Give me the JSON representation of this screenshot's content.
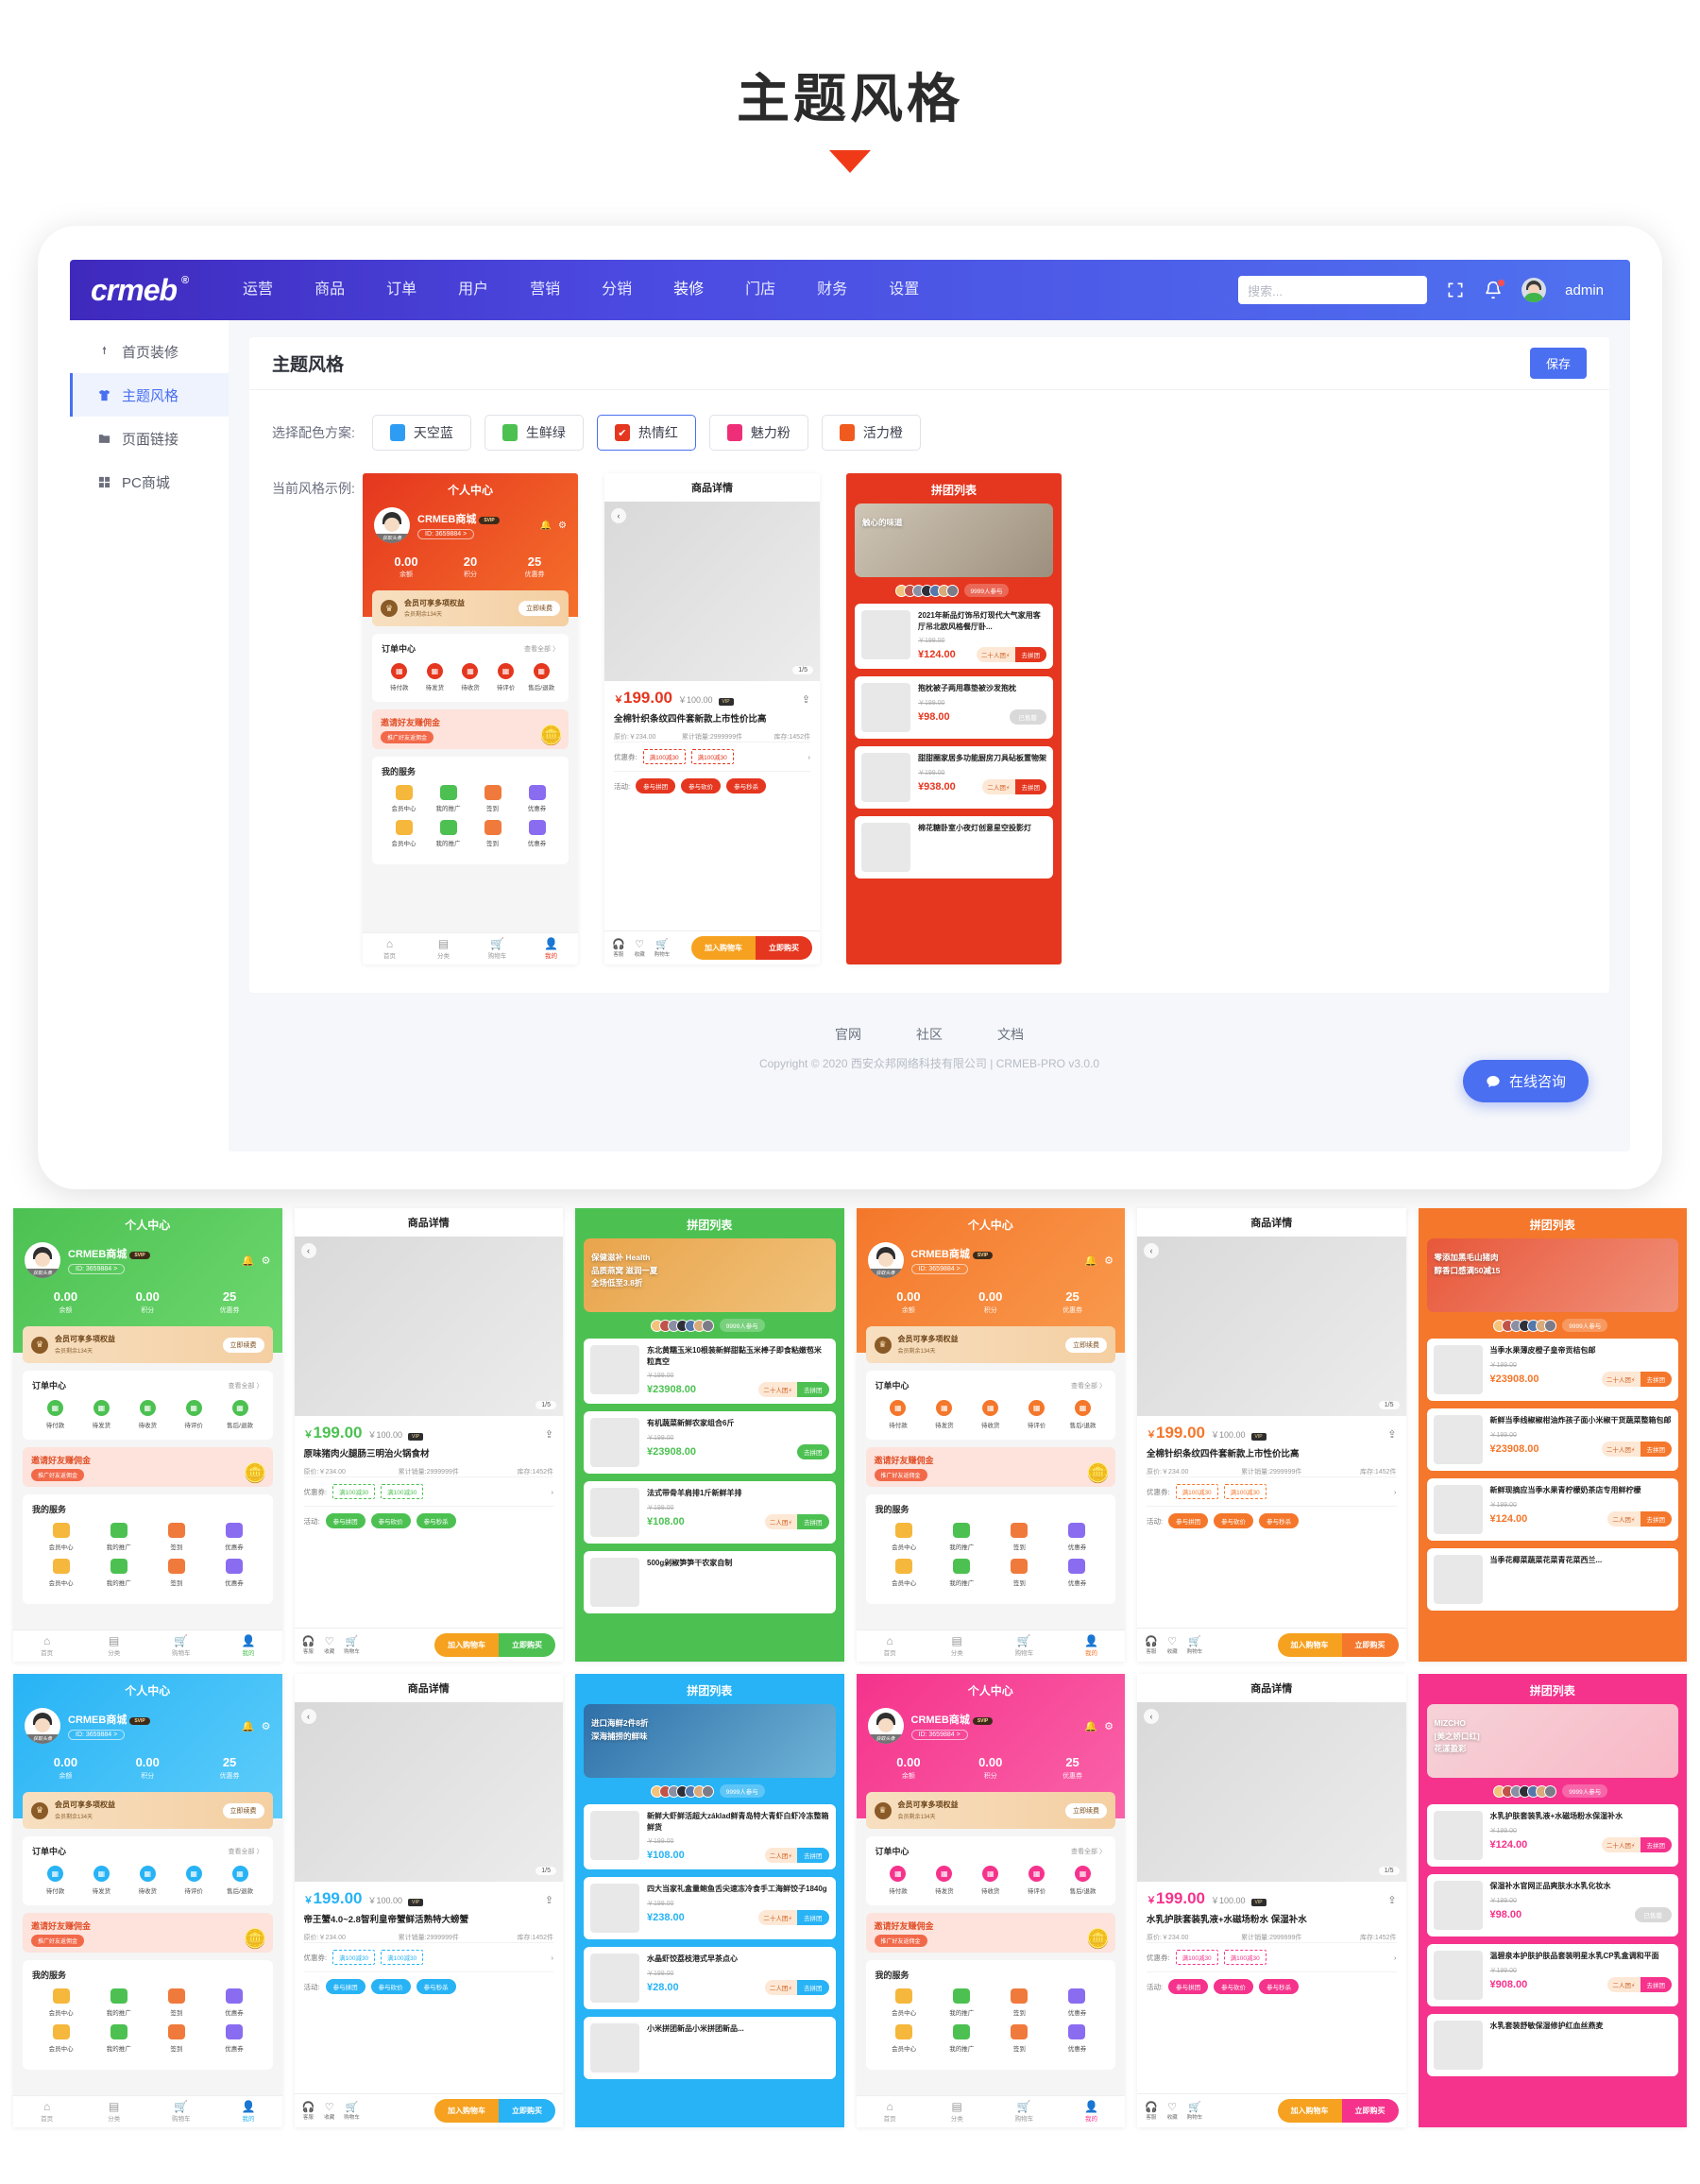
{
  "page": {
    "title": "主题风格"
  },
  "admin": {
    "logo": "crmeb",
    "logo_sup": "®",
    "nav": [
      "运营",
      "商品",
      "订单",
      "用户",
      "营销",
      "分销",
      "装修",
      "门店",
      "财务",
      "设置"
    ],
    "active_nav": "装修",
    "search_placeholder": "搜索...",
    "user_name": "admin",
    "icons": {
      "fullscreen": "fullscreen-icon",
      "bell": "bell-icon",
      "avatar": "avatar-icon",
      "search": "search-icon"
    }
  },
  "sidebar": {
    "items": [
      {
        "label": "首页装修",
        "icon": "pin-icon",
        "active": false
      },
      {
        "label": "主题风格",
        "icon": "shirt-icon",
        "active": true
      },
      {
        "label": "页面链接",
        "icon": "folder-icon",
        "active": false
      },
      {
        "label": "PC商城",
        "icon": "grid-icon",
        "active": false
      }
    ]
  },
  "card": {
    "title": "主题风格",
    "save_label": "保存",
    "scheme_label": "选择配色方案:",
    "schemes": [
      {
        "label": "天空蓝",
        "color": "#2f9cf4",
        "selected": false
      },
      {
        "label": "生鲜绿",
        "color": "#4cc152",
        "selected": false
      },
      {
        "label": "热情红",
        "color": "#e5361f",
        "selected": true
      },
      {
        "label": "魅力粉",
        "color": "#ef2e78",
        "selected": false
      },
      {
        "label": "活力橙",
        "color": "#f05a1e",
        "selected": false
      }
    ],
    "preview_label": "当前风格示例:"
  },
  "footer": {
    "links": [
      "官网",
      "社区",
      "文档"
    ],
    "copyright": "Copyright © 2020 西安众邦网络科技有限公司 | CRMEB-PRO v3.0.0",
    "chat_label": "在线咨询"
  },
  "mobile": {
    "user_center": {
      "title": "个人中心",
      "user_name": "CRMEB商城",
      "avatar_caption": "获取头像",
      "vip_tag": "SVIP",
      "user_id": "ID: 3659884 >",
      "stats": [
        {
          "value": "0.00",
          "label": "余额"
        },
        {
          "value": "0.00",
          "label": "积分"
        },
        {
          "value": "25",
          "label": "优惠券"
        }
      ],
      "stats_main": [
        {
          "value": "0.00",
          "label": "余额"
        },
        {
          "value": "20",
          "label": "积分"
        },
        {
          "value": "25",
          "label": "优惠券"
        }
      ],
      "vip_title": "会员可享多项权益",
      "vip_sub": "会员剩余134天",
      "vip_btn": "立即续费",
      "order_title": "订单中心",
      "order_all": "查看全部 〉",
      "order_items": [
        "待付款",
        "待发货",
        "待收货",
        "待评价",
        "售后/退款"
      ],
      "promo_title": "邀请好友赚佣金",
      "promo_btn": "推广好友返佣金",
      "service_title": "我的服务",
      "services": [
        "会员中心",
        "我的推广",
        "签到",
        "优惠券"
      ],
      "tabbar": [
        "首页",
        "分类",
        "购物车",
        "我的"
      ],
      "tabbar_active": "我的"
    },
    "product_detail": {
      "title": "商品详情",
      "counter": "1/5",
      "price_now": "199.00",
      "price_old": "￥100.00",
      "vip_tag": "VIP",
      "name": "全棉针织条纹四件套新款上市性价比高",
      "original": "原价:￥234.00",
      "sales": "累计销量:2999999件",
      "stock": "库存:1452件",
      "coupon_label": "优惠券:",
      "coupons": [
        "满100减30",
        "满100减30"
      ],
      "activity_label": "活动:",
      "activities": [
        "参与拼团",
        "参与砍价",
        "参与秒杀"
      ],
      "mini": [
        "客服",
        "收藏",
        "购物车"
      ],
      "cta_cart": "加入购物车",
      "cta_buy": "立即购买"
    },
    "group_list": {
      "title": "拼团列表",
      "join_count": "9999人参与",
      "banner_red": {
        "line1": "触心的味道"
      },
      "banner_green": {
        "tag": "保健滋补 Health",
        "line1": "品质燕窝 滋润一夏",
        "line2": "全场低至3.8折"
      },
      "banner_orange": {
        "line1": "零添加黑毛山猪肉",
        "line2": "醇香口感满50减15"
      },
      "banner_blue": {
        "line1": "进口海鲜2件8折",
        "line2": "深海捕捞的鲜味"
      },
      "banner_pink": {
        "brand": "MIZCHO",
        "line1": "[美之娇口红]",
        "line2": "花漾盈彩"
      },
      "items_red": [
        {
          "name": "2021年新品灯饰吊灯现代大气家用客厅吊北欧风格餐厅卧...",
          "old": "￥199.00",
          "now": "¥124.00",
          "team": "二十人团",
          "cta": "去拼团",
          "sold": false
        },
        {
          "name": "抱枕被子两用靠垫被沙发抱枕",
          "old": "￥199.00",
          "now": "¥98.00",
          "team": "",
          "cta": "已售罄",
          "sold": true
        },
        {
          "name": "甜甜圈家居多功能厨房刀具砧板置物架",
          "old": "￥199.00",
          "now": "¥938.00",
          "team": "二人团",
          "cta": "去拼团",
          "sold": false
        },
        {
          "name": "棉花糖卧室小夜灯创意星空投影灯",
          "old": "",
          "now": "",
          "team": "",
          "cta": "",
          "sold": false
        }
      ],
      "items_green": [
        {
          "name": "东北黄糯玉米10根装新鲜甜黏玉米棒子即食粘嫩苞米粒真空",
          "old": "￥199.00",
          "now": "¥23908.00",
          "team": "二十人团",
          "cta": "去拼团",
          "sold": false
        },
        {
          "name": "有机蔬菜新鲜农家组合6斤",
          "old": "￥199.00",
          "now": "¥23908.00",
          "team": "",
          "cta": "去拼团",
          "sold": false
        },
        {
          "name": "法式带骨羊肩排1斤新鲜羊排",
          "old": "￥199.00",
          "now": "¥108.00",
          "team": "二人团",
          "cta": "去拼团",
          "sold": false
        },
        {
          "name": "500g剁椒笋笋干农家自制",
          "old": "",
          "now": "",
          "team": "",
          "cta": "",
          "sold": false
        }
      ],
      "items_orange": [
        {
          "name": "当季水果薄皮橙子皇帝贡桔包邮",
          "old": "￥199.00",
          "now": "¥23908.00",
          "team": "二十人团",
          "cta": "去拼团",
          "sold": false
        },
        {
          "name": "新鲜当季线椒椒柑油炸孩子面小米椒干货蔬菜整箱包邮",
          "old": "￥199.00",
          "now": "¥23908.00",
          "team": "二十人团",
          "cta": "去拼团",
          "sold": false
        },
        {
          "name": "新鲜现摘应当季水果青柠檬奶茶店专用鲜柠檬",
          "old": "￥199.00",
          "now": "¥124.00",
          "team": "二人团",
          "cta": "去拼团",
          "sold": false
        },
        {
          "name": "当季花椰菜蔬菜花菜青花菜西兰...",
          "old": "",
          "now": "",
          "team": "",
          "cta": "",
          "sold": false
        }
      ],
      "items_blue": [
        {
          "name": "新鲜大虾鲜活超大základ鲜青岛特大青虾白虾冷冻整箱鲜货",
          "old": "￥199.00",
          "now": "¥108.00",
          "team": "二人团",
          "cta": "去拼团",
          "sold": false
        },
        {
          "name": "四大当家礼盒量鲍鱼舌尖速冻冷食手工海鲜饺子1840g",
          "old": "￥199.00",
          "now": "¥238.00",
          "team": "二十人团",
          "cta": "去拼团",
          "sold": false
        },
        {
          "name": "水晶虾饺荔枝港式早茶点心",
          "old": "￥199.00",
          "now": "¥28.00",
          "team": "二人团",
          "cta": "去拼团",
          "sold": false
        },
        {
          "name": "小米拼团新品小米拼团新品...",
          "old": "",
          "now": "",
          "team": "",
          "cta": "",
          "sold": false
        }
      ],
      "items_pink": [
        {
          "name": "水乳护肤套装乳液+水磁场粉水保湿补水",
          "old": "￥199.00",
          "now": "¥124.00",
          "team": "二十人团",
          "cta": "去拼团",
          "sold": false
        },
        {
          "name": "保湿补水官网正品爽肤水水乳化妆水",
          "old": "￥199.00",
          "now": "¥98.00",
          "team": "",
          "cta": "已售罄",
          "sold": true
        },
        {
          "name": "温碧泉本护肤护肤品套装明星水乳CP乳盒调和平面",
          "old": "￥199.00",
          "now": "¥908.00",
          "team": "二人团",
          "cta": "去拼团",
          "sold": false
        },
        {
          "name": "水乳套装舒敏保湿修护红血丝燕麦",
          "old": "",
          "now": "",
          "team": "",
          "cta": "",
          "sold": false
        }
      ],
      "product_names_detail": {
        "green": "原味猪肉火腿肠三明治火锅食材",
        "red": "全棉针织条纹四件套新款上市性价比高",
        "blue": "帝王蟹4.0~2.8智利皇帝蟹鲜活熟特大螃蟹",
        "pink": "水乳护肤套装乳液+水磁场粉水 保湿补水"
      }
    }
  },
  "variants": [
    {
      "theme": "green",
      "c": "#4cc152",
      "c2": "#6ed86f",
      "kind": "user_center"
    },
    {
      "theme": "green",
      "c": "#4cc152",
      "c2": "#6ed86f",
      "kind": "product_detail"
    },
    {
      "theme": "green",
      "c": "#4cc152",
      "c2": "#6ed86f",
      "kind": "group_list"
    },
    {
      "theme": "orange",
      "c": "#f4772b",
      "c2": "#f99b4e",
      "kind": "user_center"
    },
    {
      "theme": "orange",
      "c": "#f4772b",
      "c2": "#f99b4e",
      "kind": "product_detail"
    },
    {
      "theme": "orange",
      "c": "#f4772b",
      "c2": "#f99b4e",
      "kind": "group_list"
    },
    {
      "theme": "blue",
      "c": "#27b3f5",
      "c2": "#5ecdfa",
      "kind": "user_center"
    },
    {
      "theme": "blue",
      "c": "#27b3f5",
      "c2": "#5ecdfa",
      "kind": "product_detail"
    },
    {
      "theme": "blue",
      "c": "#27b3f5",
      "c2": "#5ecdfa",
      "kind": "group_list"
    },
    {
      "theme": "pink",
      "c": "#f5338c",
      "c2": "#fa63a9",
      "kind": "user_center"
    },
    {
      "theme": "pink",
      "c": "#f5338c",
      "c2": "#fa63a9",
      "kind": "product_detail"
    },
    {
      "theme": "pink",
      "c": "#f5338c",
      "c2": "#fa63a9",
      "kind": "group_list"
    }
  ]
}
